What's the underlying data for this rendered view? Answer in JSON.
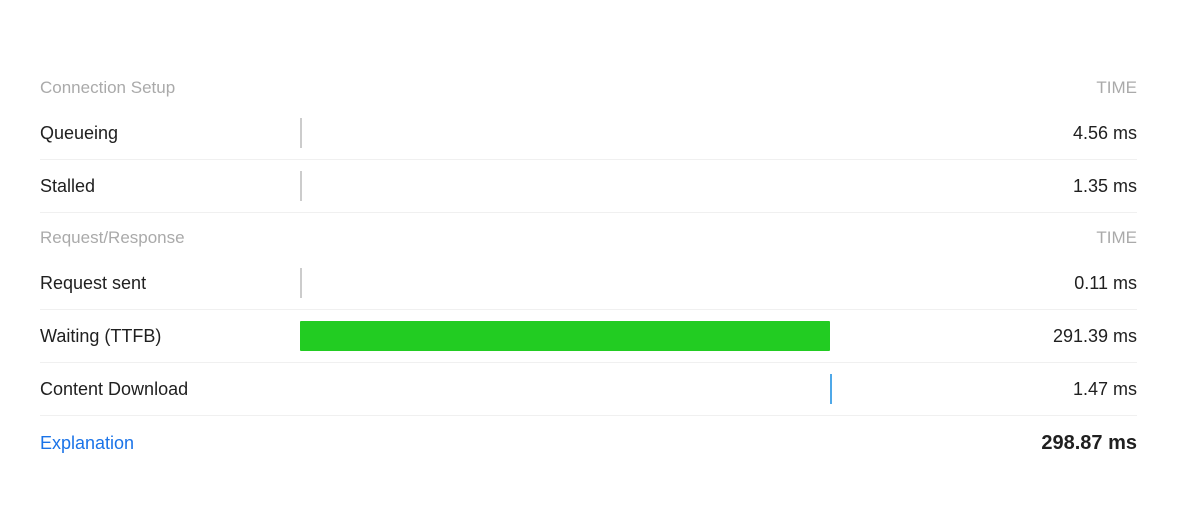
{
  "sections": [
    {
      "type": "section-header",
      "label": "Connection Setup",
      "time": "TIME"
    },
    {
      "type": "data-row",
      "label": "Queueing",
      "bar": "tick",
      "time": "4.56 ms"
    },
    {
      "type": "data-row",
      "label": "Stalled",
      "bar": "tick",
      "time": "1.35 ms"
    },
    {
      "type": "section-header",
      "label": "Request/Response",
      "time": "TIME"
    },
    {
      "type": "data-row",
      "label": "Request sent",
      "bar": "tick",
      "time": "0.11 ms"
    },
    {
      "type": "data-row",
      "label": "Waiting (TTFB)",
      "bar": "ttfb",
      "time": "291.39 ms"
    },
    {
      "type": "data-row",
      "label": "Content Download",
      "bar": "blue-tick",
      "time": "1.47 ms"
    }
  ],
  "footer": {
    "explanation_label": "Explanation",
    "total_time": "298.87 ms"
  }
}
